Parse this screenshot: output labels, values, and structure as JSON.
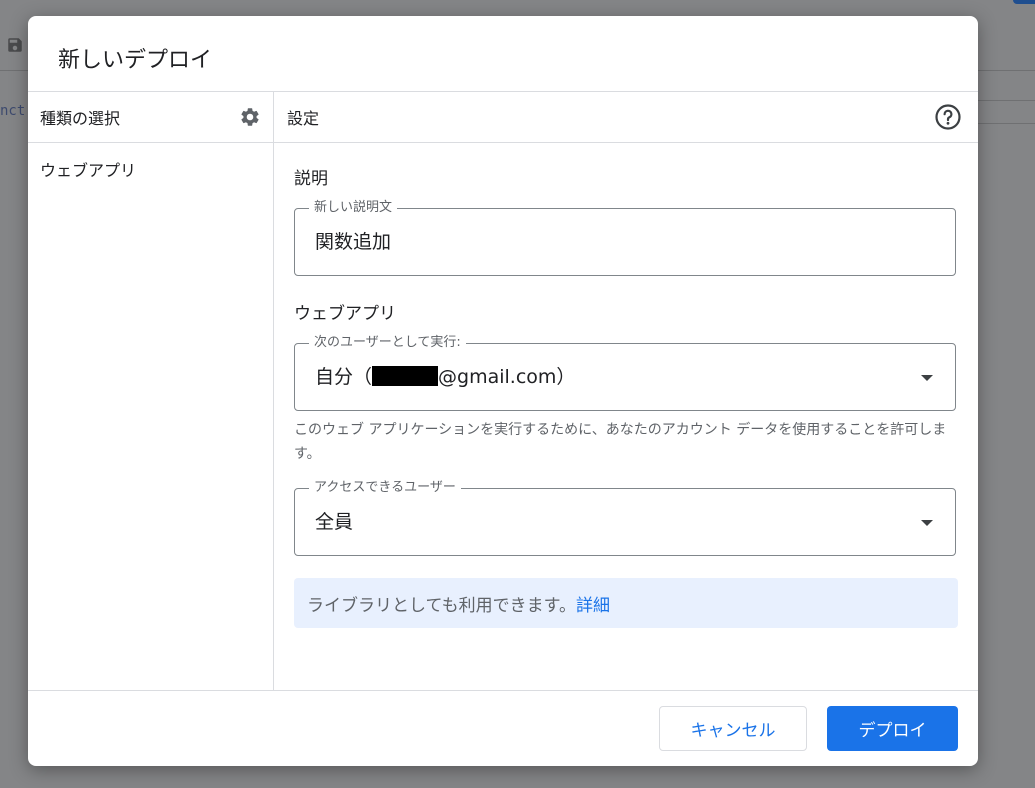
{
  "background": {
    "code_fragment": "nct"
  },
  "dialog": {
    "title": "新しいデプロイ",
    "sidebar": {
      "title": "種類の選択",
      "items": [
        {
          "label": "ウェブアプリ"
        }
      ]
    },
    "main": {
      "title": "設定",
      "description_section": {
        "label": "説明",
        "field": {
          "legend": "新しい説明文",
          "value": "関数追加"
        }
      },
      "webapp_section": {
        "label": "ウェブアプリ",
        "execute_as": {
          "legend": "次のユーザーとして実行:",
          "value_prefix": "自分（",
          "value_suffix": "@gmail.com）"
        },
        "hint": "このウェブ アプリケーションを実行するために、あなたのアカウント データを使用することを許可します。",
        "access": {
          "legend": "アクセスできるユーザー",
          "value": "全員"
        }
      },
      "info": {
        "text": "ライブラリとしても利用できます。",
        "link": "詳細"
      }
    },
    "footer": {
      "cancel_label": "キャンセル",
      "deploy_label": "デプロイ"
    }
  },
  "colors": {
    "accent": "#1a73e8",
    "info_background": "#e8f0fe",
    "border": "#dadce0"
  }
}
